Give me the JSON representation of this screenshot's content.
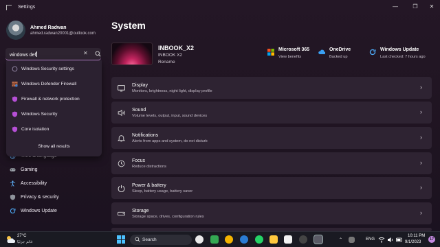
{
  "window": {
    "title": "Settings",
    "controls": {
      "minimize": "—",
      "maximize": "❐",
      "close": "✕"
    }
  },
  "user": {
    "name": "Ahmed Radwan",
    "email": "ahmed.radwan20001@outlook.com"
  },
  "search": {
    "value": "windows def",
    "results": [
      {
        "label": "Windows Security settings",
        "icon": "shield-outline-icon"
      },
      {
        "label": "Windows Defender Firewall",
        "icon": "firewall-icon"
      },
      {
        "label": "Firewall & network protection",
        "icon": "security-shield-icon"
      },
      {
        "label": "Windows Security",
        "icon": "security-shield-icon"
      },
      {
        "label": "Core isolation",
        "icon": "security-shield-icon"
      }
    ],
    "show_all": "Show all results"
  },
  "sidebar": {
    "items": [
      {
        "label": "Time & language",
        "icon": "globe-icon"
      },
      {
        "label": "Gaming",
        "icon": "gamepad-icon"
      },
      {
        "label": "Accessibility",
        "icon": "accessibility-icon"
      },
      {
        "label": "Privacy & security",
        "icon": "shield-icon"
      },
      {
        "label": "Windows Update",
        "icon": "update-icon"
      }
    ]
  },
  "main": {
    "title": "System",
    "device": {
      "name": "INBOOK_X2",
      "model": "INBOOK X2",
      "rename": "Rename"
    },
    "tiles": [
      {
        "title": "Microsoft 365",
        "subtitle": "View benefits",
        "icon": "microsoft-365-icon"
      },
      {
        "title": "OneDrive",
        "subtitle": "Backed up",
        "icon": "onedrive-icon"
      },
      {
        "title": "Windows Update",
        "subtitle": "Last checked: 7 hours ago",
        "icon": "windows-update-icon"
      }
    ],
    "cards": [
      {
        "title": "Display",
        "subtitle": "Monitors, brightness, night light, display profile",
        "icon": "display-icon"
      },
      {
        "title": "Sound",
        "subtitle": "Volume levels, output, input, sound devices",
        "icon": "sound-icon"
      },
      {
        "title": "Notifications",
        "subtitle": "Alerts from apps and system, do not disturb",
        "icon": "bell-icon"
      },
      {
        "title": "Focus",
        "subtitle": "Reduce distractions",
        "icon": "focus-icon"
      },
      {
        "title": "Power & battery",
        "subtitle": "Sleep, battery usage, battery saver",
        "icon": "power-icon"
      },
      {
        "title": "Storage",
        "subtitle": "Storage space, drives, configuration rules",
        "icon": "storage-icon"
      }
    ]
  },
  "taskbar": {
    "weather": {
      "temp": "27°C",
      "condition": "غائم جزئيًا"
    },
    "search_label": "Search",
    "tray": {
      "language": "ENG",
      "time": "10:11 PM",
      "date": "9/1/2023",
      "notifications": "17"
    }
  },
  "colors": {
    "accent": "#c48bd8",
    "background": "#1f1421",
    "card": "#2e2332",
    "taskbar": "#1a1a22"
  }
}
